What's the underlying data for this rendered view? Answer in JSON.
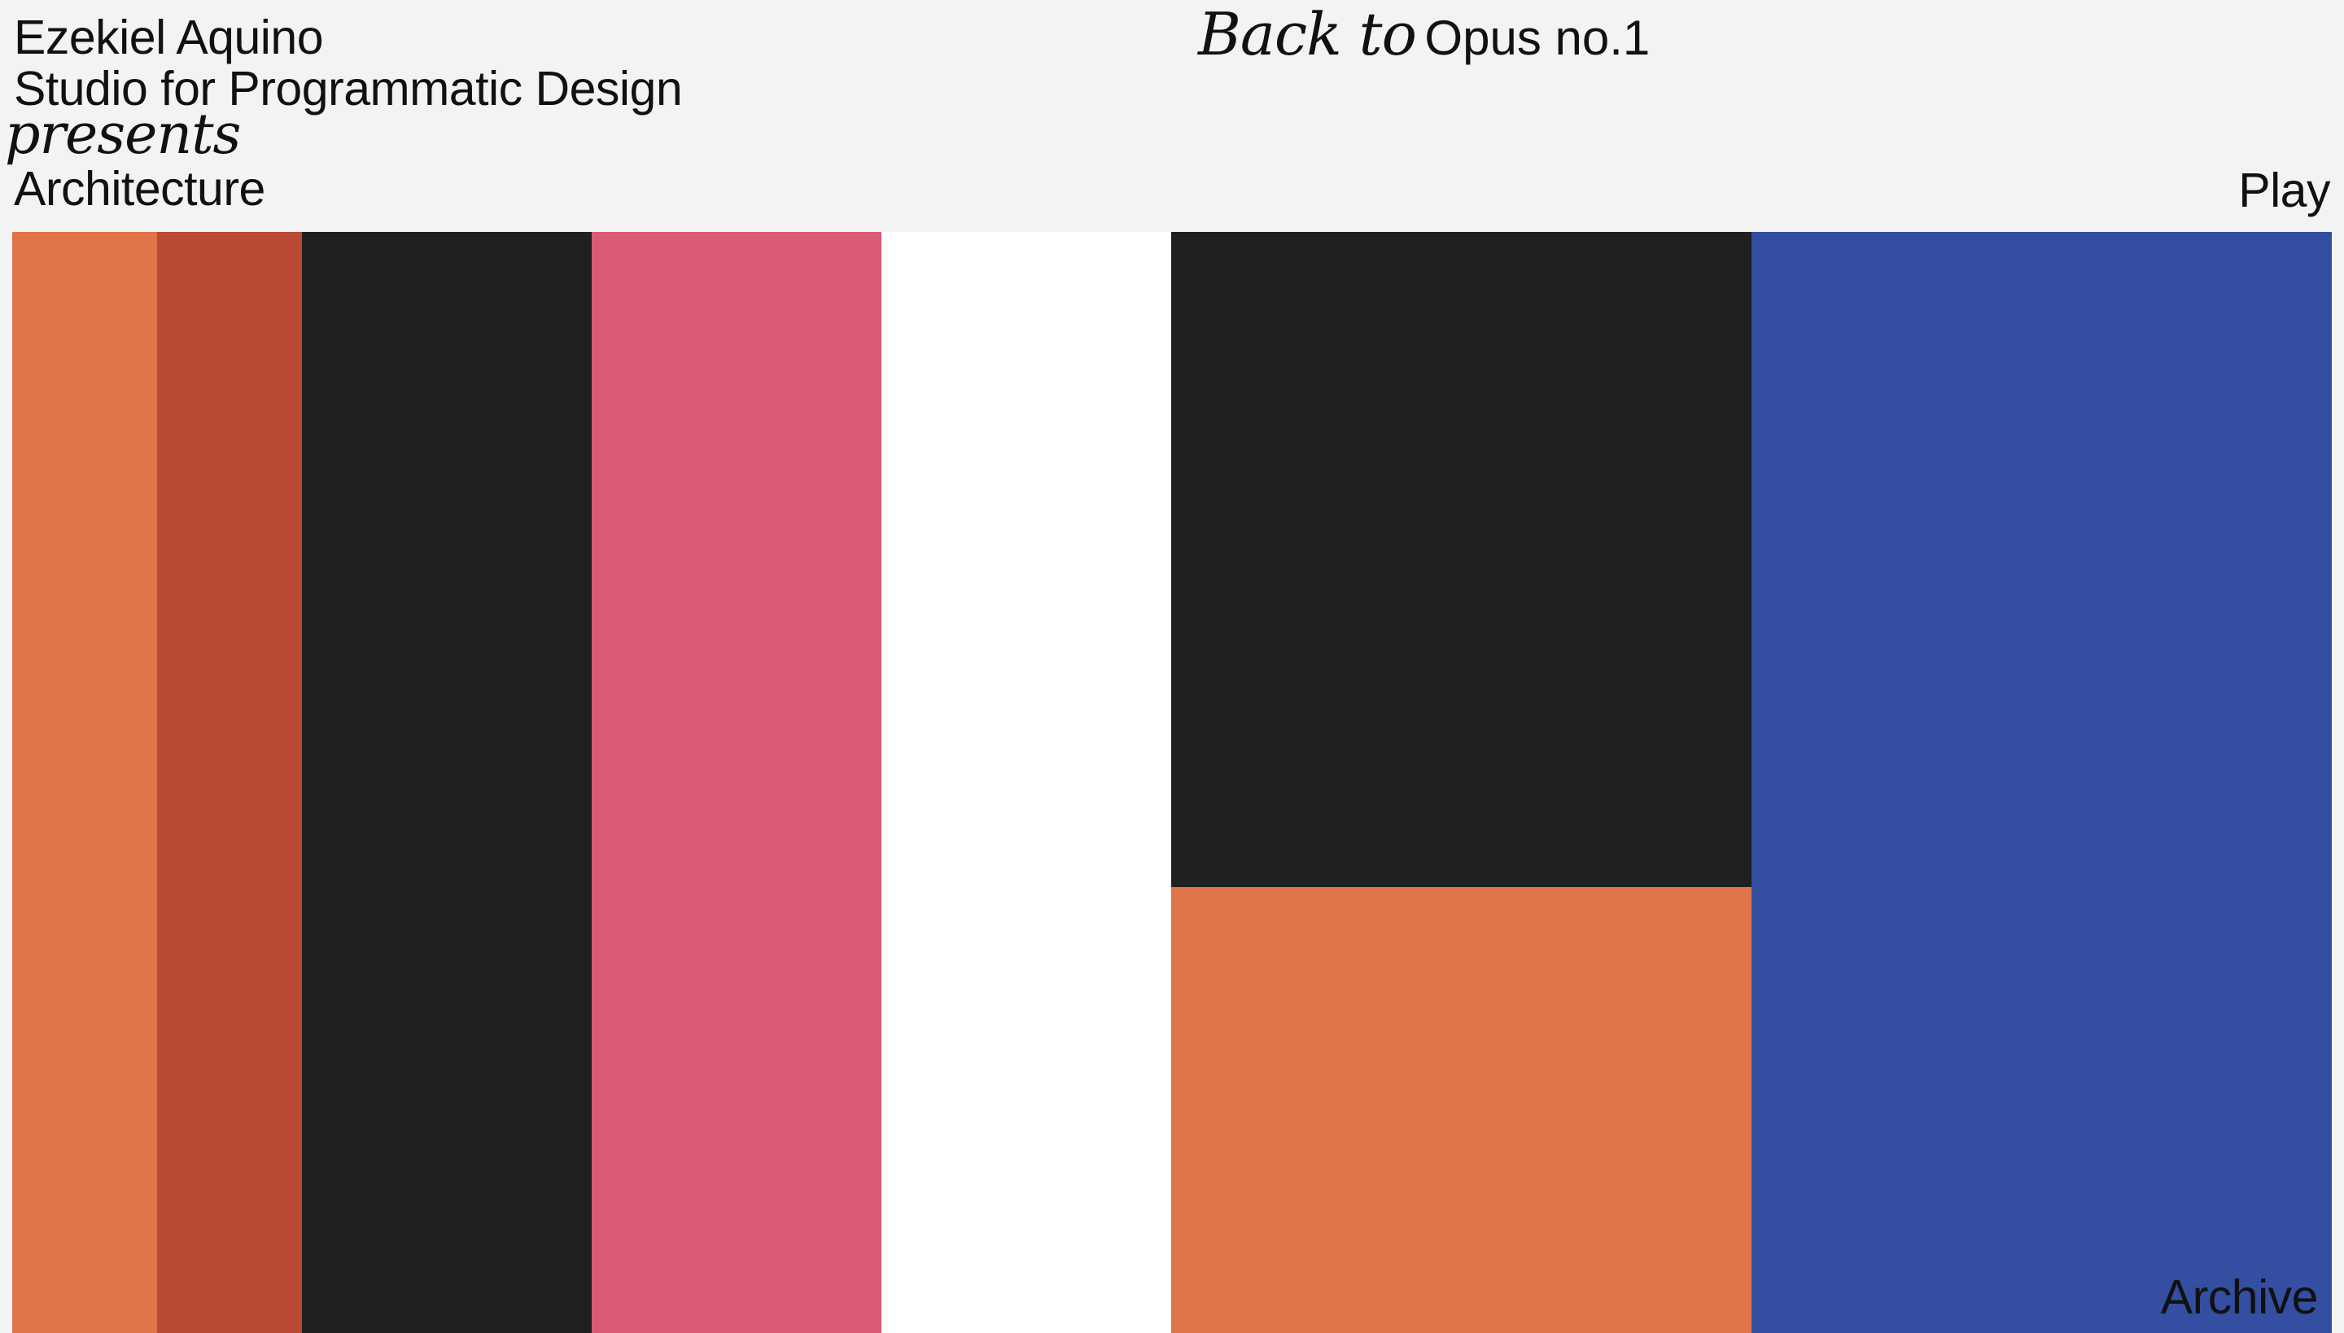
{
  "header": {
    "studio_name": "Ezekiel Aquino",
    "studio_tagline": "Studio for Programmatic Design",
    "presents": "presents",
    "work_title": "Architecture",
    "back_prefix": "Back to",
    "back_target": "Opus no.1",
    "play_label": "Play"
  },
  "footer": {
    "archive_label": "Archive"
  },
  "colors": {
    "page_background": "#f3f3f3",
    "text": "#111111",
    "orange": "#de7448",
    "rust": "#ba4a33",
    "black": "#202020",
    "pink": "#d95b75",
    "white": "#ffffff",
    "blue": "#344fa2"
  },
  "composition": {
    "blocks": [
      {
        "name": "orange-stripe",
        "color": "#de7448"
      },
      {
        "name": "rust-stripe",
        "color": "#ba4a33"
      },
      {
        "name": "black-stripe",
        "color": "#202020"
      },
      {
        "name": "pink-stripe",
        "color": "#d95b75"
      },
      {
        "name": "white-stripe",
        "color": "#ffffff"
      },
      {
        "name": "black-block",
        "color": "#202020"
      },
      {
        "name": "orange-block",
        "color": "#de7448"
      },
      {
        "name": "blue-stripe",
        "color": "#344fa2"
      }
    ]
  }
}
